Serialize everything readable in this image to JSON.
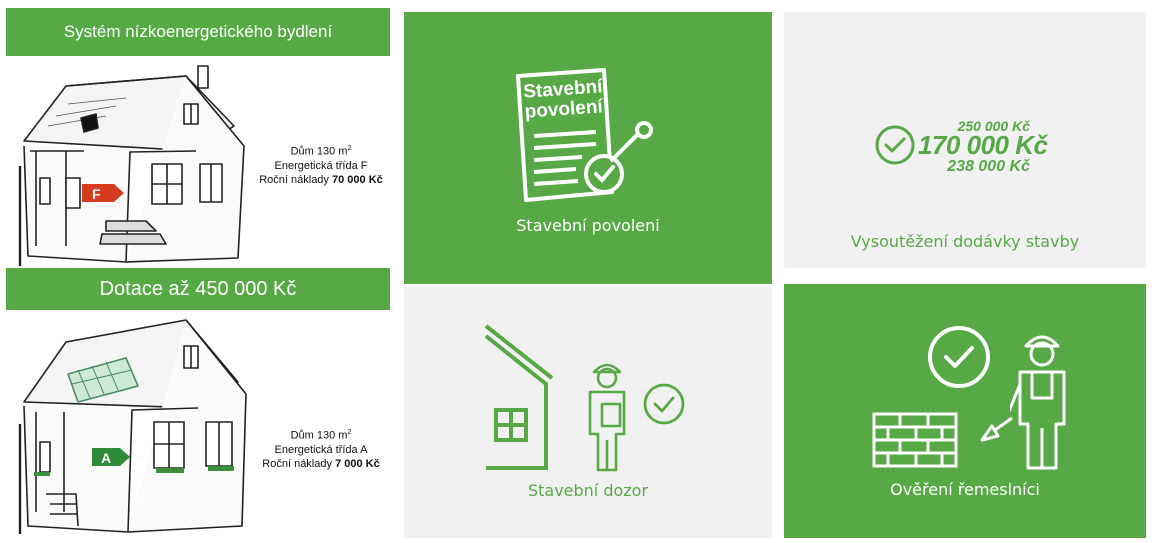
{
  "left_panel": {
    "banner_top": "Systém nízkoenergetického bydlení",
    "banner_mid": "Dotace až 450 000 Kč",
    "house_before": {
      "energy_class_badge": "F",
      "area": "Dům 130 m",
      "area_sup": "2",
      "energy_class": "Energetická třída F",
      "cost_label": "Roční náklady",
      "cost_value": "70 000 Kč"
    },
    "house_after": {
      "energy_class_badge": "A",
      "area": "Dům 130 m",
      "area_sup": "2",
      "energy_class": "Energetická třída A",
      "cost_label": "Roční náklady",
      "cost_value": "7 000 Kč"
    }
  },
  "tiles": {
    "permit": {
      "doc_title_line1": "Stavební",
      "doc_title_line2": "povolení",
      "label": "Stavební povoleni"
    },
    "tender": {
      "price_top": "250 000 Kč",
      "price_main": "170 000 Kč",
      "price_bottom": "238 000 Kč",
      "label": "Vysoutěžení dodávky stavby"
    },
    "supervision": {
      "label": "Stavební dozor"
    },
    "craftsmen": {
      "label": "Ověření řemeslníci"
    }
  },
  "colors": {
    "brand_green": "#57a946",
    "tile_light": "#f1f1f1",
    "badge_red": "#d53b1f",
    "badge_green": "#2e8b3a"
  },
  "icons": [
    "permit-document-icon",
    "stamp-icon",
    "check-circle-icon",
    "house-outline-icon",
    "inspector-icon",
    "brick-wall-icon",
    "worker-icon",
    "trowel-icon"
  ]
}
